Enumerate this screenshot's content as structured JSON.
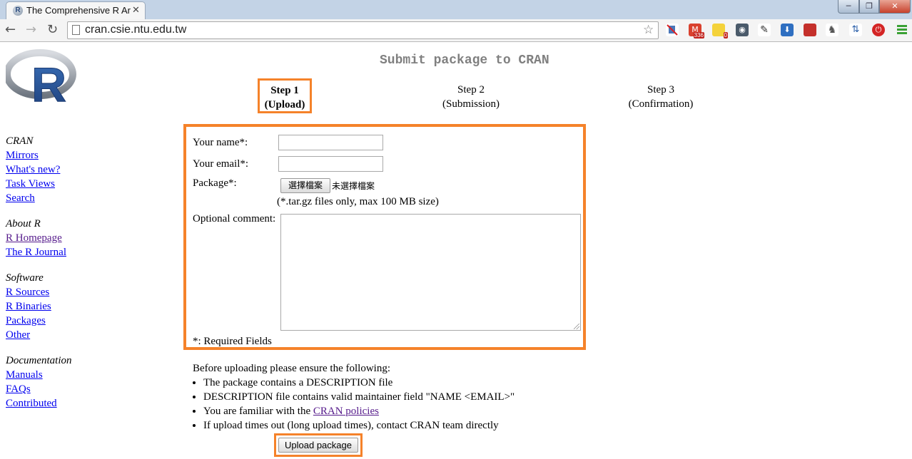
{
  "browser": {
    "tab_title": "The Comprehensive R Ar",
    "tab_close": "✕",
    "url": "cran.csie.ntu.edu.tw",
    "window_controls": {
      "minimize": "─",
      "maximize": "❐",
      "close": "✕"
    },
    "extensions": [
      {
        "icon": "tracker-block-icon"
      },
      {
        "icon": "gmail-icon",
        "badge": "336"
      },
      {
        "icon": "sticky-notes-icon",
        "badge": "0"
      },
      {
        "icon": "camera-icon"
      },
      {
        "icon": "pin-icon"
      },
      {
        "icon": "download-icon"
      },
      {
        "icon": "bookmark-icon"
      },
      {
        "icon": "elephant-icon"
      },
      {
        "icon": "arrows-icon"
      },
      {
        "icon": "power-icon"
      }
    ],
    "accent_color": "#f5822a"
  },
  "page": {
    "title": "Submit package to CRAN",
    "steps": [
      {
        "title": "Step 1",
        "subtitle": "(Upload)"
      },
      {
        "title": "Step 2",
        "subtitle": "(Submission)"
      },
      {
        "title": "Step 3",
        "subtitle": "(Confirmation)"
      }
    ]
  },
  "sidebar": {
    "groups": [
      {
        "heading": "CRAN",
        "links": [
          "Mirrors",
          "What's new?",
          "Task Views",
          "Search"
        ]
      },
      {
        "heading": "About R",
        "links": [
          "R Homepage",
          "The R Journal"
        ]
      },
      {
        "heading": "Software",
        "links": [
          "R Sources",
          "R Binaries",
          "Packages",
          "Other"
        ]
      },
      {
        "heading": "Documentation",
        "links": [
          "Manuals",
          "FAQs",
          "Contributed"
        ]
      }
    ]
  },
  "form": {
    "name_label": "Your name*:",
    "email_label": "Your email*:",
    "package_label": "Package*:",
    "file_button": "選擇檔案",
    "file_status": "未選擇檔案",
    "file_hint": "(*.tar.gz files only, max 100 MB size)",
    "comment_label": "Optional comment:",
    "required_note": "*: Required Fields",
    "name_value": "",
    "email_value": "",
    "comment_value": ""
  },
  "instructions": {
    "intro": "Before uploading please ensure the following:",
    "item1": "The package contains a DESCRIPTION file",
    "item2": "DESCRIPTION file contains valid maintainer field \"NAME <EMAIL>\"",
    "item3_prefix": "You are familiar with the ",
    "item3_link": "CRAN policies",
    "item4": "If upload times out (long upload times), contact CRAN team directly"
  },
  "upload_button": "Upload package"
}
